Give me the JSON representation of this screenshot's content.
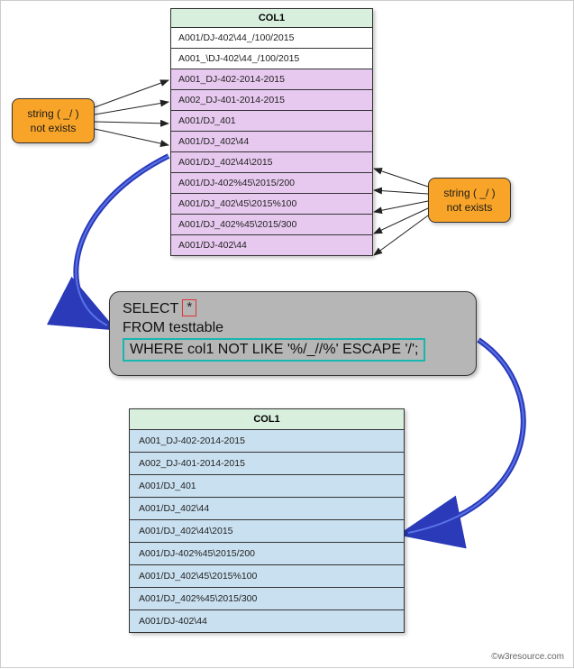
{
  "colors": {
    "highlight": "#e7c9ef",
    "result": "#c9e0f0",
    "callout": "#f8a428",
    "header": "#d8efdd",
    "sqlpanel": "#b6b6b6",
    "arrow": "#2a3ab8"
  },
  "table1": {
    "header": "COL1",
    "rows": [
      {
        "text": "A001/DJ-402\\44_/100/2015",
        "match": false
      },
      {
        "text": "A001_\\DJ-402\\44_/100/2015",
        "match": false
      },
      {
        "text": "A001_DJ-402-2014-2015",
        "match": true
      },
      {
        "text": "A002_DJ-401-2014-2015",
        "match": true
      },
      {
        "text": "A001/DJ_401",
        "match": true
      },
      {
        "text": "A001/DJ_402\\44",
        "match": true
      },
      {
        "text": "A001/DJ_402\\44\\2015",
        "match": true
      },
      {
        "text": "A001/DJ-402%45\\2015/200",
        "match": true
      },
      {
        "text": "A001/DJ_402\\45\\2015%100",
        "match": true
      },
      {
        "text": "A001/DJ_402%45\\2015/300",
        "match": true
      },
      {
        "text": "A001/DJ-402\\44",
        "match": true
      }
    ]
  },
  "callout_left": {
    "line1": "string ( _/ )",
    "line2": "not exists"
  },
  "callout_right": {
    "line1": "string ( _/ )",
    "line2": "not exists"
  },
  "sql": {
    "select": "SELECT",
    "star": "*",
    "from": "FROM testtable",
    "where": "WHERE col1   NOT LIKE '%/_//%' ESCAPE '/';"
  },
  "result": {
    "header": "COL1",
    "rows": [
      "A001_DJ-402-2014-2015",
      "A002_DJ-401-2014-2015",
      "A001/DJ_401",
      "A001/DJ_402\\44",
      "A001/DJ_402\\44\\2015",
      "A001/DJ-402%45\\2015/200",
      "A001/DJ_402\\45\\2015%100",
      "A001/DJ_402%45\\2015/300",
      "A001/DJ-402\\44"
    ]
  },
  "copyright": "©w3resource.com"
}
